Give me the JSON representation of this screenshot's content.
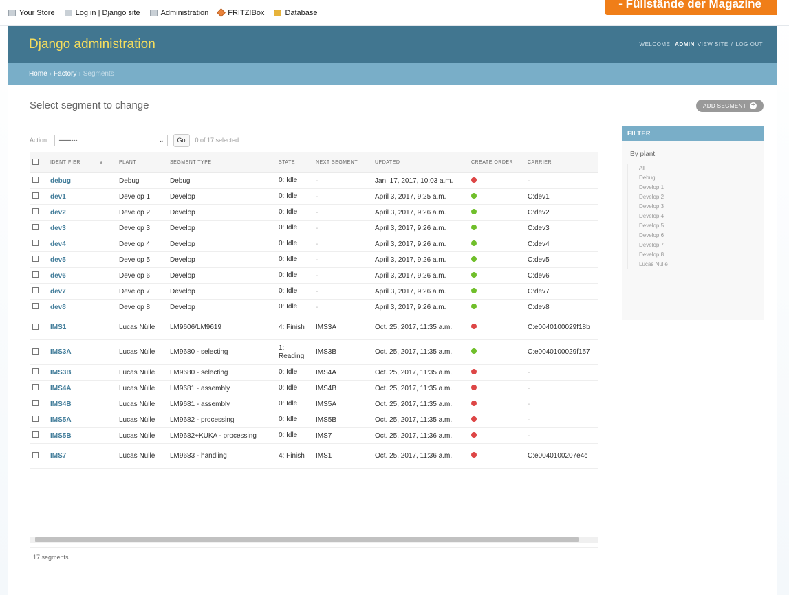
{
  "bookmarks": [
    {
      "label": "Your Store",
      "icon": "page-icon"
    },
    {
      "label": "Log in | Django site",
      "icon": "page-icon"
    },
    {
      "label": "Administration",
      "icon": "page-icon"
    },
    {
      "label": "FRITZ!Box",
      "icon": "fritzbox-icon"
    },
    {
      "label": "Database",
      "icon": "database-icon"
    }
  ],
  "banner": {
    "text": "- Füllstände der Magazine"
  },
  "header": {
    "brand": "Django administration",
    "welcome": "WELCOME,",
    "username": "ADMIN",
    "view_site": "VIEW SITE",
    "divider": "/",
    "log_out": "LOG OUT"
  },
  "breadcrumbs": {
    "home": "Home",
    "sep": "›",
    "app": "Factory",
    "current": "Segments"
  },
  "page": {
    "title": "Select segment to change",
    "add_button": "ADD SEGMENT"
  },
  "actions": {
    "label": "Action:",
    "select_value": "---------",
    "go": "Go",
    "counter": "0 of 17 selected"
  },
  "table": {
    "columns": [
      "IDENTIFIER",
      "PLANT",
      "SEGMENT TYPE",
      "STATE",
      "NEXT SEGMENT",
      "UPDATED",
      "CREATE ORDER",
      "CARRIER"
    ],
    "rows": [
      {
        "identifier": "debug",
        "plant": "Debug",
        "type": "Debug",
        "state": "0: Idle",
        "next": "-",
        "updated": "Jan. 17, 2017, 10:03 a.m.",
        "create_order": "no",
        "carrier": "-"
      },
      {
        "identifier": "dev1",
        "plant": "Develop 1",
        "type": "Develop",
        "state": "0: Idle",
        "next": "-",
        "updated": "April 3, 2017, 9:25 a.m.",
        "create_order": "yes",
        "carrier": "C:dev1"
      },
      {
        "identifier": "dev2",
        "plant": "Develop 2",
        "type": "Develop",
        "state": "0: Idle",
        "next": "-",
        "updated": "April 3, 2017, 9:26 a.m.",
        "create_order": "yes",
        "carrier": "C:dev2"
      },
      {
        "identifier": "dev3",
        "plant": "Develop 3",
        "type": "Develop",
        "state": "0: Idle",
        "next": "-",
        "updated": "April 3, 2017, 9:26 a.m.",
        "create_order": "yes",
        "carrier": "C:dev3"
      },
      {
        "identifier": "dev4",
        "plant": "Develop 4",
        "type": "Develop",
        "state": "0: Idle",
        "next": "-",
        "updated": "April 3, 2017, 9:26 a.m.",
        "create_order": "yes",
        "carrier": "C:dev4"
      },
      {
        "identifier": "dev5",
        "plant": "Develop 5",
        "type": "Develop",
        "state": "0: Idle",
        "next": "-",
        "updated": "April 3, 2017, 9:26 a.m.",
        "create_order": "yes",
        "carrier": "C:dev5"
      },
      {
        "identifier": "dev6",
        "plant": "Develop 6",
        "type": "Develop",
        "state": "0: Idle",
        "next": "-",
        "updated": "April 3, 2017, 9:26 a.m.",
        "create_order": "yes",
        "carrier": "C:dev6"
      },
      {
        "identifier": "dev7",
        "plant": "Develop 7",
        "type": "Develop",
        "state": "0: Idle",
        "next": "-",
        "updated": "April 3, 2017, 9:26 a.m.",
        "create_order": "yes",
        "carrier": "C:dev7"
      },
      {
        "identifier": "dev8",
        "plant": "Develop 8",
        "type": "Develop",
        "state": "0: Idle",
        "next": "-",
        "updated": "April 3, 2017, 9:26 a.m.",
        "create_order": "yes",
        "carrier": "C:dev8"
      },
      {
        "identifier": "IMS1",
        "plant": "Lucas Nülle",
        "type": "LM9606/LM9619",
        "state": "4: Finish",
        "next": "IMS3A",
        "updated": "Oct. 25, 2017, 11:35 a.m.",
        "create_order": "no",
        "carrier": "C:e0040100029f18b"
      },
      {
        "identifier": "IMS3A",
        "plant": "Lucas Nülle",
        "type": "LM9680 - selecting",
        "state": "1: Reading",
        "next": "IMS3B",
        "updated": "Oct. 25, 2017, 11:35 a.m.",
        "create_order": "yes",
        "carrier": "C:e0040100029f157"
      },
      {
        "identifier": "IMS3B",
        "plant": "Lucas Nülle",
        "type": "LM9680 - selecting",
        "state": "0: Idle",
        "next": "IMS4A",
        "updated": "Oct. 25, 2017, 11:35 a.m.",
        "create_order": "no",
        "carrier": "-"
      },
      {
        "identifier": "IMS4A",
        "plant": "Lucas Nülle",
        "type": "LM9681 - assembly",
        "state": "0: Idle",
        "next": "IMS4B",
        "updated": "Oct. 25, 2017, 11:35 a.m.",
        "create_order": "no",
        "carrier": "-"
      },
      {
        "identifier": "IMS4B",
        "plant": "Lucas Nülle",
        "type": "LM9681 - assembly",
        "state": "0: Idle",
        "next": "IMS5A",
        "updated": "Oct. 25, 2017, 11:35 a.m.",
        "create_order": "no",
        "carrier": "-"
      },
      {
        "identifier": "IMS5A",
        "plant": "Lucas Nülle",
        "type": "LM9682 - processing",
        "state": "0: Idle",
        "next": "IMS5B",
        "updated": "Oct. 25, 2017, 11:35 a.m.",
        "create_order": "no",
        "carrier": "-"
      },
      {
        "identifier": "IMS5B",
        "plant": "Lucas Nülle",
        "type": "LM9682+KUKA - processing",
        "state": "0: Idle",
        "next": "IMS7",
        "updated": "Oct. 25, 2017, 11:36 a.m.",
        "create_order": "no",
        "carrier": "-"
      },
      {
        "identifier": "IMS7",
        "plant": "Lucas Nülle",
        "type": "LM9683 - handling",
        "state": "4: Finish",
        "next": "IMS1",
        "updated": "Oct. 25, 2017, 11:36 a.m.",
        "create_order": "no",
        "carrier": "C:e0040100207e4c"
      }
    ]
  },
  "paginator": {
    "text": "17 segments"
  },
  "filter": {
    "title": "FILTER",
    "by": "By plant",
    "options": [
      "All",
      "Debug",
      "Develop 1",
      "Develop 2",
      "Develop 3",
      "Develop 4",
      "Develop 5",
      "Develop 6",
      "Develop 7",
      "Develop 8",
      "Lucas Nülle"
    ]
  },
  "colors": {
    "header_bg": "#417690",
    "breadcrumb_bg": "#79aec8",
    "brand_text": "#f5dd5d",
    "link": "#447e9b",
    "banner": "#f07e18",
    "status_yes": "#70bf2b",
    "status_no": "#dd4646"
  }
}
